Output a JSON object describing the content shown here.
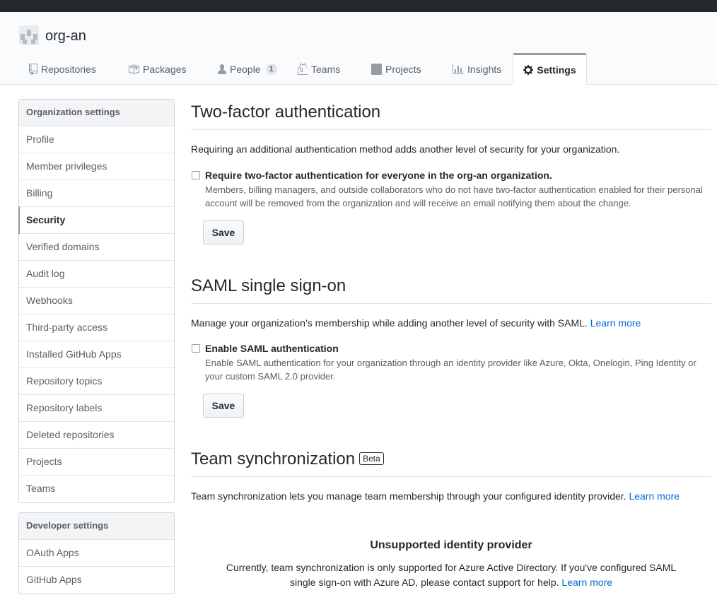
{
  "org": {
    "name": "org-an"
  },
  "tabs": [
    {
      "label": "Repositories",
      "icon": "repo-icon"
    },
    {
      "label": "Packages",
      "icon": "package-icon"
    },
    {
      "label": "People",
      "icon": "person-icon",
      "counter": "1"
    },
    {
      "label": "Teams",
      "icon": "jersey-icon"
    },
    {
      "label": "Projects",
      "icon": "project-icon"
    },
    {
      "label": "Insights",
      "icon": "graph-icon"
    },
    {
      "label": "Settings",
      "icon": "gear-icon",
      "selected": true
    }
  ],
  "sidebar": {
    "org_heading": "Organization settings",
    "org_items": [
      {
        "label": "Profile"
      },
      {
        "label": "Member privileges"
      },
      {
        "label": "Billing"
      },
      {
        "label": "Security",
        "selected": true
      },
      {
        "label": "Verified domains"
      },
      {
        "label": "Audit log"
      },
      {
        "label": "Webhooks"
      },
      {
        "label": "Third-party access"
      },
      {
        "label": "Installed GitHub Apps"
      },
      {
        "label": "Repository topics"
      },
      {
        "label": "Repository labels"
      },
      {
        "label": "Deleted repositories"
      },
      {
        "label": "Projects"
      },
      {
        "label": "Teams"
      }
    ],
    "dev_heading": "Developer settings",
    "dev_items": [
      {
        "label": "OAuth Apps"
      },
      {
        "label": "GitHub Apps"
      }
    ]
  },
  "two_factor": {
    "title": "Two-factor authentication",
    "description": "Requiring an additional authentication method adds another level of security for your organization.",
    "checkbox_label": "Require two-factor authentication for everyone in the org-an organization.",
    "note": "Members, billing managers, and outside collaborators who do not have two-factor authentication enabled for their personal account will be removed from the organization and will receive an email notifying them about the change.",
    "save_label": "Save"
  },
  "saml": {
    "title": "SAML single sign-on",
    "description": "Manage your organization’s membership while adding another level of security with SAML.",
    "learn_more": "Learn more",
    "checkbox_label": "Enable SAML authentication",
    "note": "Enable SAML authentication for your organization through an identity provider like Azure, Okta, Onelogin, Ping Identity or your custom SAML 2.0 provider.",
    "save_label": "Save"
  },
  "team_sync": {
    "title": "Team synchronization",
    "badge": "Beta",
    "description": "Team synchronization lets you manage team membership through your configured identity provider.",
    "learn_more": "Learn more",
    "unsupported_title": "Unsupported identity provider",
    "unsupported_text": "Currently, team synchronization is only supported for Azure Active Directory. If you've configured SAML single sign-on with Azure AD, please contact support for help.",
    "unsupported_link": "Learn more"
  },
  "colors": {
    "link": "#0366d6",
    "text": "#24292e",
    "muted": "#586069",
    "topbar": "#24292e"
  }
}
